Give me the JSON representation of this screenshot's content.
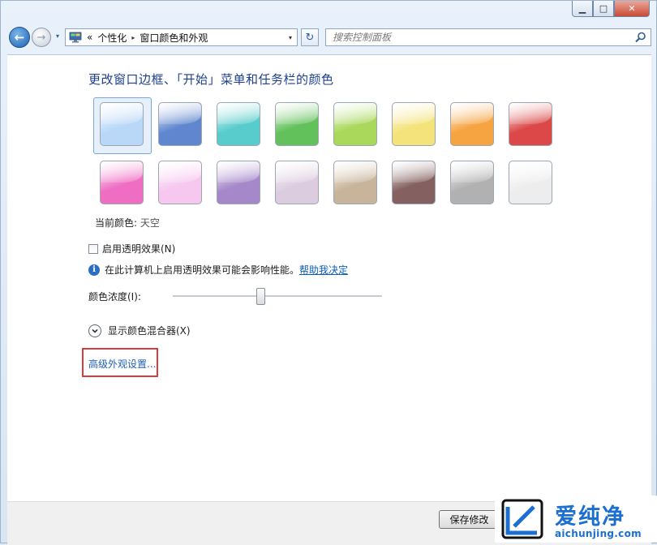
{
  "window": {
    "controls": {
      "minimize": "▁",
      "maximize": "□",
      "close": "✕"
    }
  },
  "navbar": {
    "back_icon": "←",
    "forward_icon": "→",
    "dropdown_icon": "▾",
    "address": {
      "crumb_prefix": "«",
      "crumbs": [
        "个性化",
        "窗口颜色和外观"
      ],
      "separator": "▸",
      "dropdown_icon": "▾"
    },
    "refresh_icon": "↻",
    "search_placeholder": "搜索控制面板"
  },
  "content": {
    "heading": "更改窗口边框、「开始」菜单和任务栏的颜色",
    "swatches": [
      {
        "name": "sky",
        "color": "#b9d8f8",
        "selected": true
      },
      {
        "name": "twilight",
        "color": "#5f86cf"
      },
      {
        "name": "sea",
        "color": "#58cccc"
      },
      {
        "name": "leaf",
        "color": "#62c15a"
      },
      {
        "name": "lime",
        "color": "#a9d85b"
      },
      {
        "name": "sunshine",
        "color": "#f4e37b"
      },
      {
        "name": "pumpkin",
        "color": "#f6a341"
      },
      {
        "name": "ruby",
        "color": "#dc4848"
      },
      {
        "name": "fuchsia",
        "color": "#ef6ec4"
      },
      {
        "name": "blush",
        "color": "#f6c8ef"
      },
      {
        "name": "violet",
        "color": "#a588c9"
      },
      {
        "name": "lavender",
        "color": "#dccce0"
      },
      {
        "name": "taupe",
        "color": "#c7b49b"
      },
      {
        "name": "chocolate",
        "color": "#846060"
      },
      {
        "name": "slate",
        "color": "#b1b1b1"
      },
      {
        "name": "frost",
        "color": "#ededed"
      }
    ],
    "current_color_label": "当前颜色:",
    "current_color_value": "天空",
    "transparency_label": "启用透明效果(N)",
    "transparency_checked": false,
    "info_icon": "i",
    "info_text": "在此计算机上启用透明效果可能会影响性能。",
    "help_link": "帮助我决定",
    "intensity_label": "颜色浓度(I):",
    "intensity_value": 0.42,
    "mixer_label": "显示颜色混合器(X)",
    "advanced_link": "高级外观设置..."
  },
  "footer": {
    "save_label": "保存修改"
  },
  "watermark": {
    "title": "爱纯净",
    "url": "aichunjing.com"
  }
}
